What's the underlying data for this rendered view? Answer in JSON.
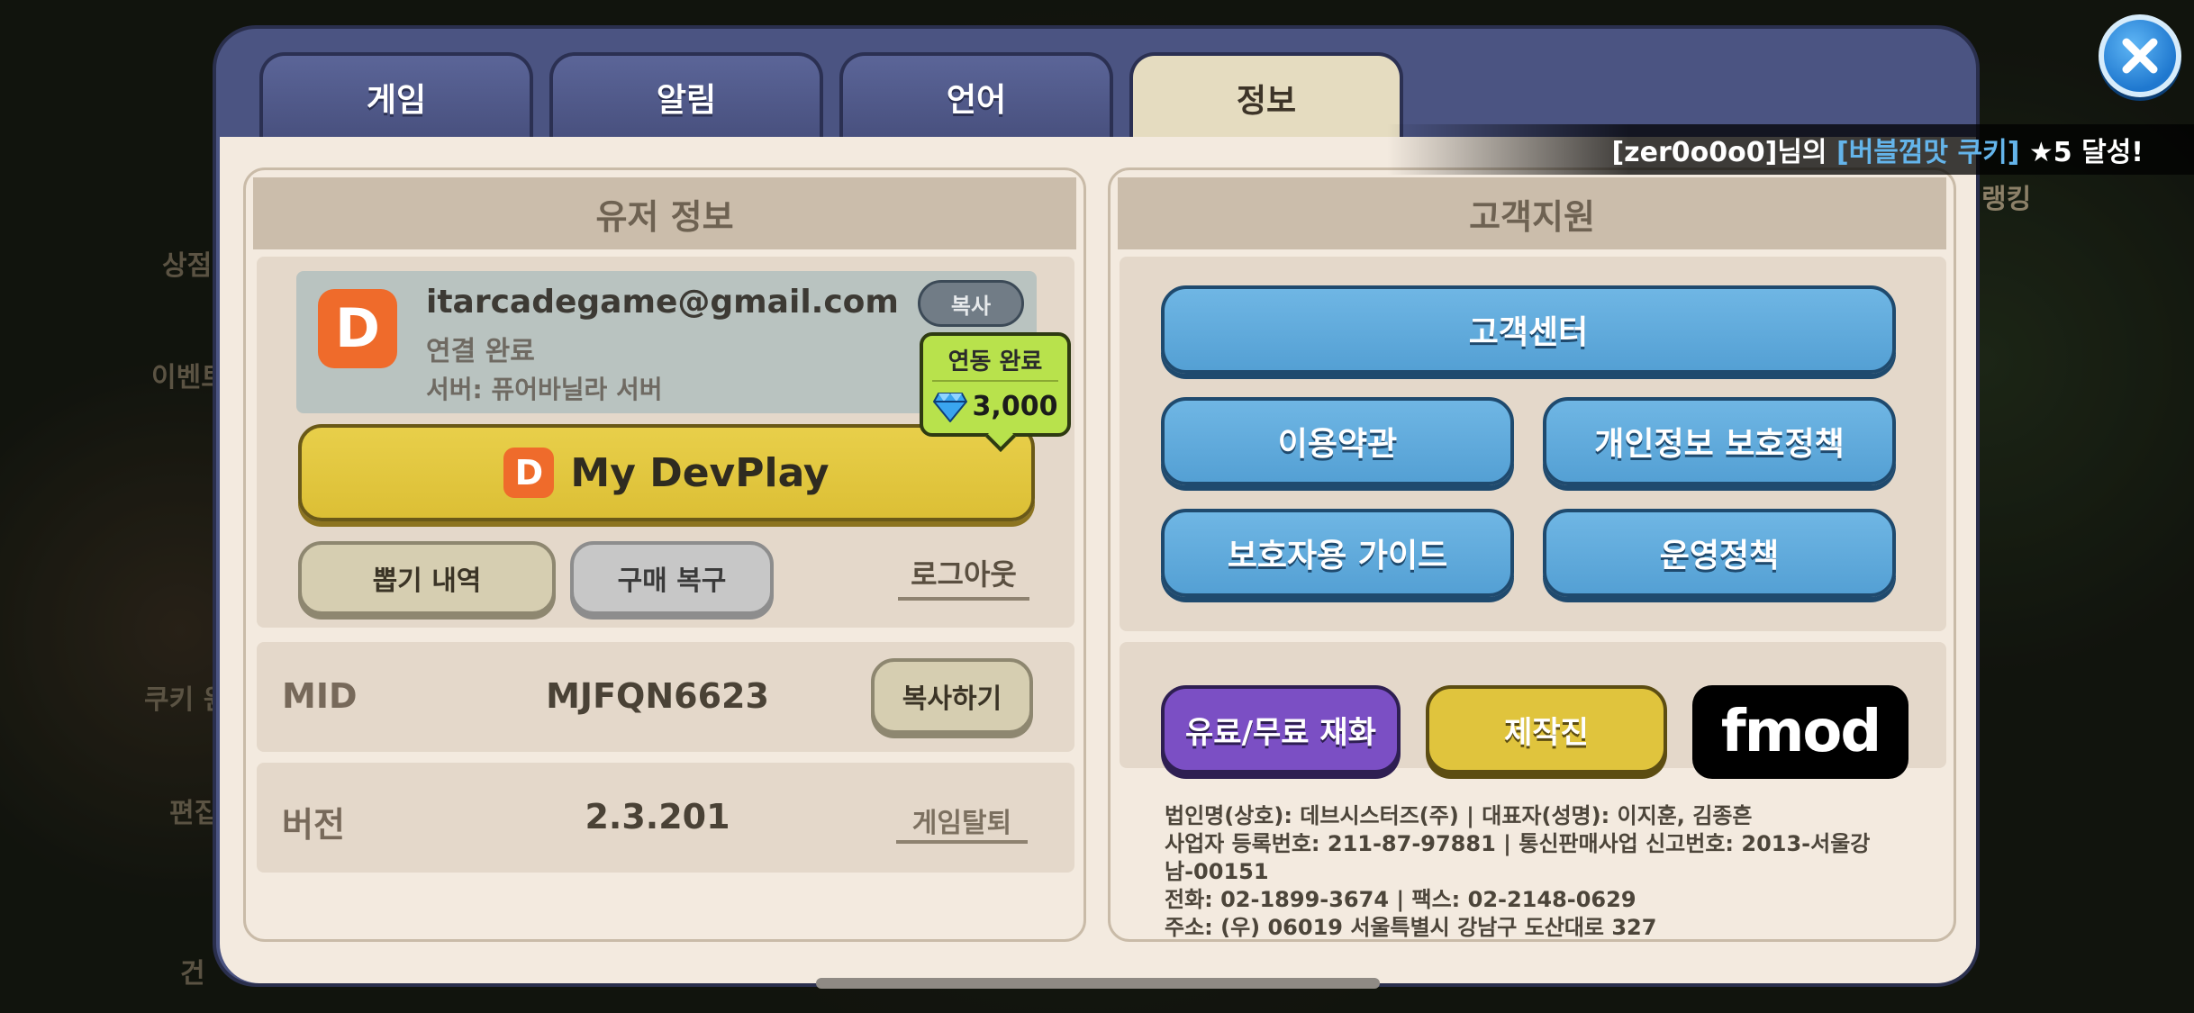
{
  "background": {
    "labels": [
      "상점",
      "이벤트",
      "쿠키 윈",
      "편집",
      "건",
      "랭킹"
    ]
  },
  "notice": {
    "prefix": "[zer0o0o0]님의 ",
    "highlight": "[버블껌맛 쿠키]",
    "suffix": " ★5 달성!"
  },
  "tabs": [
    {
      "label": "게임"
    },
    {
      "label": "알림"
    },
    {
      "label": "언어"
    },
    {
      "label": "정보"
    }
  ],
  "active_tab": "정보",
  "user_info": {
    "header": "유저 정보",
    "logo_letter": "D",
    "email": "itarcadegame@gmail.com",
    "status": "연결 완료",
    "server": "서버: 퓨어바닐라 서버",
    "copy_label": "복사",
    "linked_badge": {
      "title": "연동 완료",
      "reward": "3,000"
    },
    "devplay_label": "My DevPlay",
    "gacha_history_label": "뽑기 내역",
    "restore_label": "구매 복구",
    "logout_label": "로그아웃",
    "mid_label": "MID",
    "mid_value": "MJFQN6623",
    "mid_copy_label": "복사하기",
    "version_label": "버전",
    "version_value": "2.3.201",
    "withdraw_label": "게임탈퇴"
  },
  "support": {
    "header": "고객지원",
    "customer_center": "고객센터",
    "terms": "이용약관",
    "privacy": "개인정보 보호정책",
    "guardian_guide": "보호자용 가이드",
    "operation_policy": "운영정책",
    "paid_free": "유료/무료 재화",
    "credits": "제작진",
    "fmod": "fmod",
    "company_lines": [
      "법인명(상호): 데브시스터즈(주) | 대표자(성명): 이지훈, 김종흔",
      "사업자 등록번호: 211-87-97881 | 통신판매사업 신고번호: 2013-서울강남-00151",
      "전화: 02-1899-3674 | 팩스: 02-2148-0629",
      "주소: (우) 06019 서울특별시 강남구 도산대로 327"
    ]
  },
  "colors": {
    "modal_frame": "#4b5482",
    "active_tab": "#e5dcc0",
    "blue_button": "#5fa9dc",
    "devplay_yellow": "#e0c43d",
    "purple_button": "#7b4fc4",
    "devplay_orange": "#ef6b2b",
    "badge_green": "#b8e24c"
  },
  "icons": {
    "close": "close-icon",
    "gem": "gem-icon",
    "logo": "devplay-logo"
  }
}
